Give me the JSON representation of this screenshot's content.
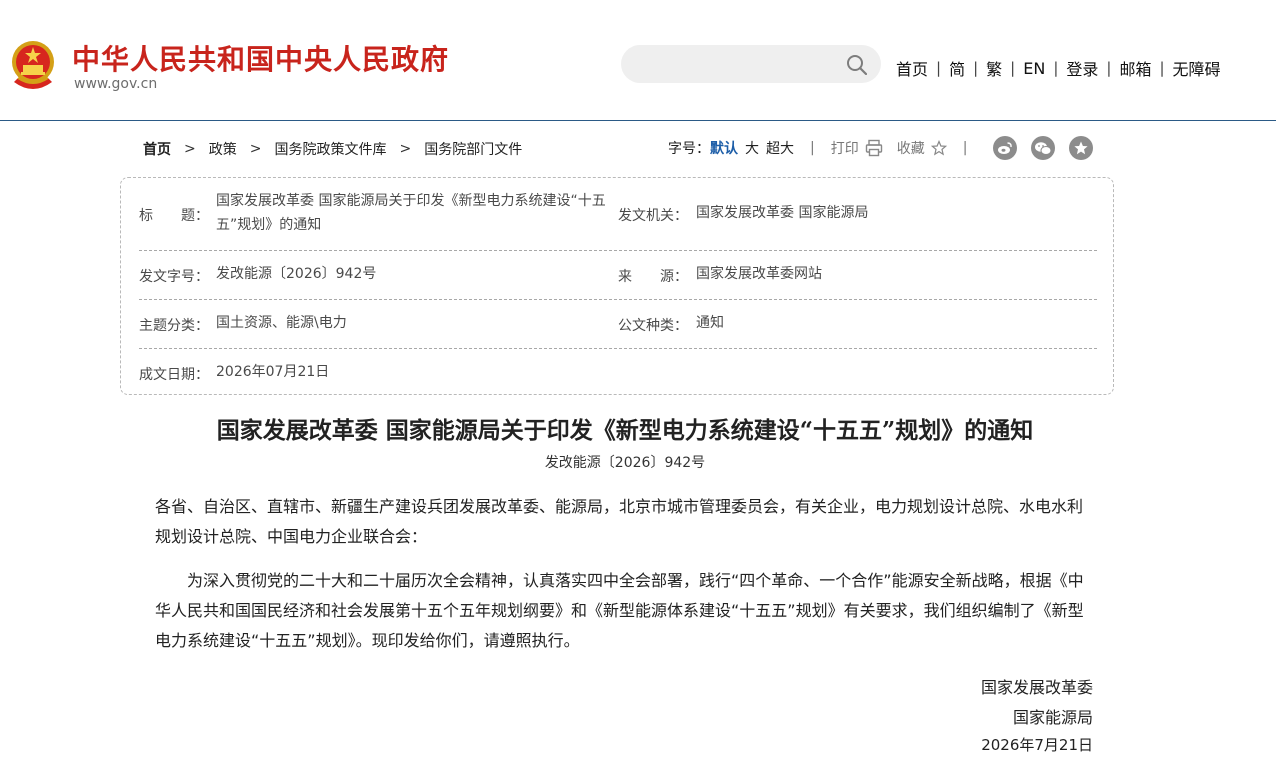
{
  "header": {
    "site_title": "中华人民共和国中央人民政府",
    "site_domain": "www.gov.cn",
    "emblem_icon": "national-emblem-icon",
    "search": {
      "placeholder": "",
      "value": ""
    },
    "nav": [
      "首页",
      "简",
      "繁",
      "EN",
      "登录",
      "邮箱",
      "无障碍"
    ],
    "nav_separator": "|"
  },
  "breadcrumb": {
    "items": [
      "首页",
      "政策",
      "国务院政策文件库",
      "国务院部门文件"
    ],
    "separator": ">"
  },
  "tools": {
    "font_size_label": "字号：",
    "font_size_options": [
      "默认",
      "大",
      "超大"
    ],
    "font_size_selected": "默认",
    "print_label": "打印",
    "favorite_label": "收藏",
    "divider": "|",
    "share_icons": [
      "weibo-icon",
      "wechat-icon",
      "star-icon"
    ]
  },
  "info": {
    "title_label": "标　　题：",
    "title_value": "国家发展改革委 国家能源局关于印发《新型电力系统建设“十五五”规划》的通知",
    "issuer_label": "发文机关：",
    "issuer_value": "国家发展改革委 国家能源局",
    "docno_label": "发文字号：",
    "docno_value": "发改能源〔2026〕942号",
    "source_label": "来　　源：",
    "source_value": "国家发展改革委网站",
    "topic_label": "主题分类：",
    "topic_value": "国土资源、能源\\电力",
    "type_label": "公文种类：",
    "type_value": "通知",
    "date_label": "成文日期：",
    "date_value": "2026年07月21日"
  },
  "article": {
    "title": "国家发展改革委 国家能源局关于印发《新型电力系统建设“十五五”规划》的通知",
    "doc_number": "发改能源〔2026〕942号",
    "addressee": "各省、自治区、直辖市、新疆生产建设兵团发展改革委、能源局，北京市城市管理委员会，有关企业，电力规划设计总院、水电水利规划设计总院、中国电力企业联合会：",
    "paragraph": "为深入贯彻党的二十大和二十届历次全会精神，认真落实四中全会部署，践行“四个革命、一个合作”能源安全新战略，根据《中华人民共和国国民经济和社会发展第十五个五年规划纲要》和《新型能源体系建设“十五五”规划》有关要求，我们组织编制了《新型电力系统建设“十五五”规划》。现印发给你们，请遵照执行。",
    "signatures": [
      "国家发展改革委",
      "国家能源局"
    ],
    "sign_date": "2026年7月21日"
  },
  "colors": {
    "brand_red": "#c8241c",
    "header_rule": "#2b5a86",
    "active_link": "#1d5ea8",
    "icon_gray": "#8c8c8c"
  }
}
